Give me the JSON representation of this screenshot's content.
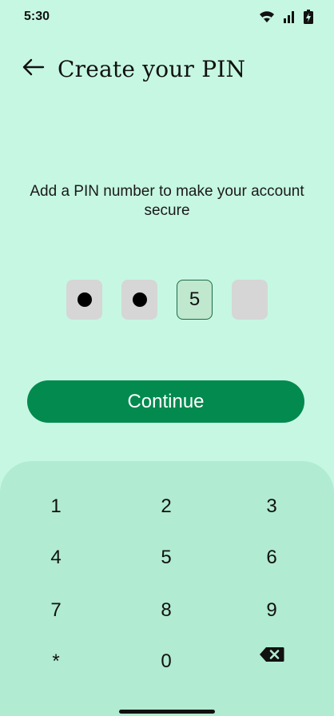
{
  "status_bar": {
    "time": "5:30",
    "icons": [
      "wifi-icon",
      "signal-icon",
      "battery-charging-icon"
    ]
  },
  "header": {
    "back_icon": "arrow-left-icon",
    "title": "Create your PIN"
  },
  "instruction": "Add a PIN number to make your account secure",
  "pin": {
    "length": 4,
    "boxes": [
      {
        "state": "filled",
        "value": ""
      },
      {
        "state": "filled",
        "value": ""
      },
      {
        "state": "active",
        "value": "5"
      },
      {
        "state": "empty",
        "value": ""
      }
    ]
  },
  "continue_label": "Continue",
  "keypad": {
    "keys": [
      "1",
      "2",
      "3",
      "4",
      "5",
      "6",
      "7",
      "8",
      "9",
      "*",
      "0"
    ],
    "backspace_icon": "backspace-icon"
  },
  "colors": {
    "background": "#c6f7e2",
    "keypad_background": "#b1ebd1",
    "primary": "#028a4f",
    "pin_box": "#d6d6d6",
    "pin_box_active": "#bfe8cf"
  }
}
